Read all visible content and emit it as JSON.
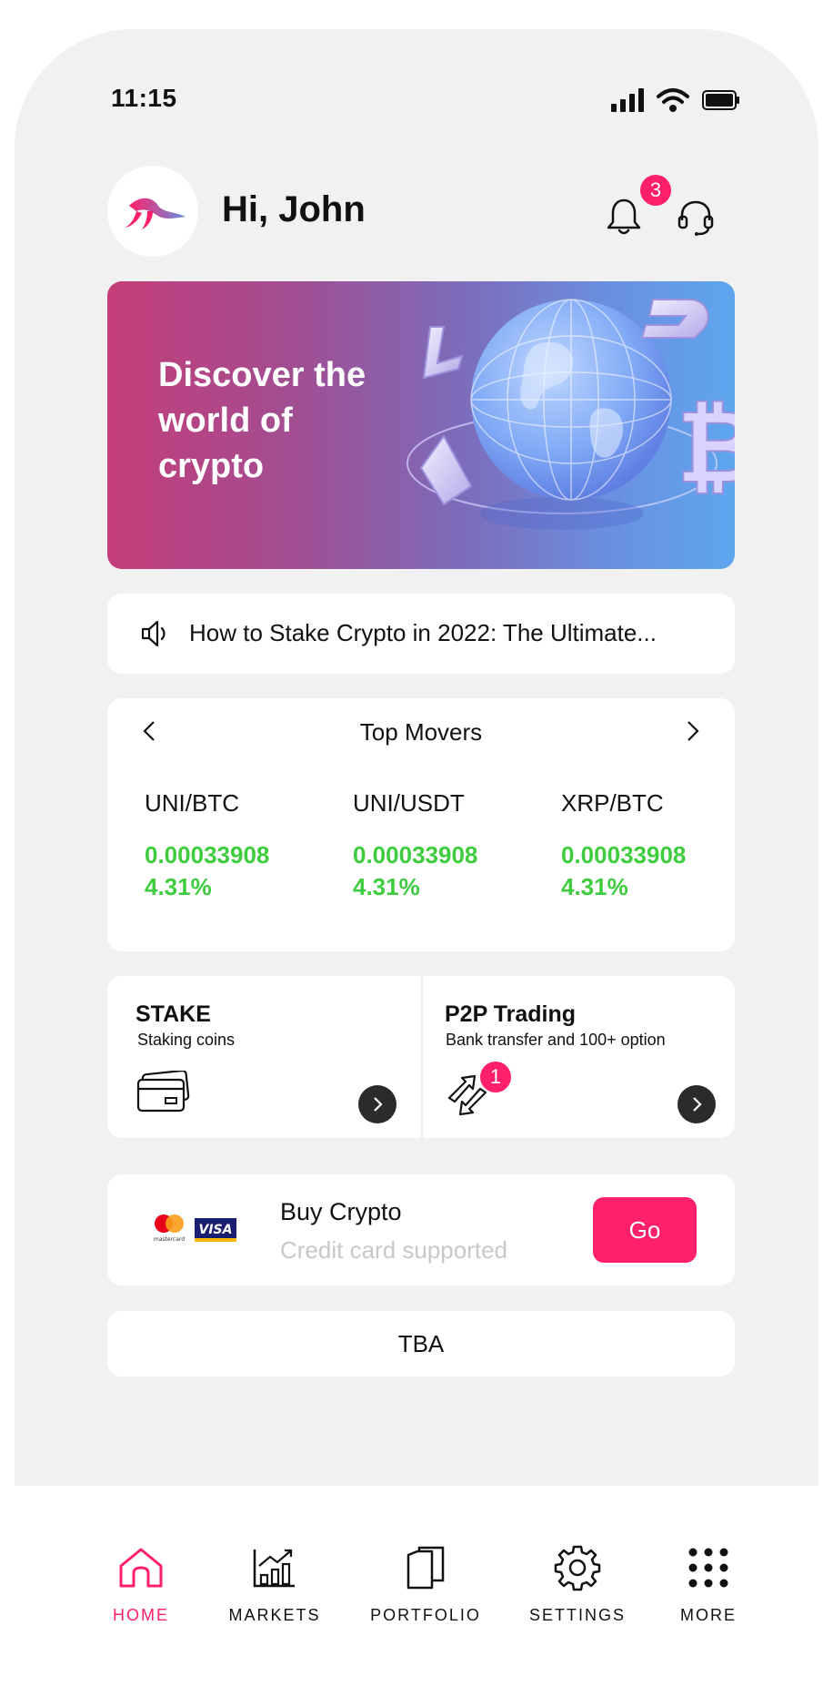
{
  "status": {
    "time": "11:15"
  },
  "header": {
    "greeting": "Hi, John",
    "notifications_count": "3"
  },
  "banner": {
    "title": "Discover the world of crypto"
  },
  "news": {
    "headline": "How to Stake Crypto in 2022: The Ultimate..."
  },
  "movers": {
    "title": "Top Movers",
    "items": [
      {
        "pair": "UNI/BTC",
        "price": "0.00033908",
        "change": "4.31%"
      },
      {
        "pair": "UNI/USDT",
        "price": "0.00033908",
        "change": "4.31%"
      },
      {
        "pair": "XRP/BTC",
        "price": "0.00033908",
        "change": "4.31%"
      }
    ]
  },
  "actions": {
    "stake": {
      "title": "STAKE",
      "subtitle": "Staking coins"
    },
    "p2p": {
      "title": "P2P Trading",
      "subtitle": "Bank transfer and 100+ option",
      "badge": "1"
    }
  },
  "buy": {
    "title": "Buy Crypto",
    "subtitle": "Credit card supported",
    "button": "Go",
    "visa_text": "VISA",
    "mastercard_text": "mastercard"
  },
  "tba": {
    "label": "TBA"
  },
  "nav": {
    "items": [
      {
        "label": "HOME",
        "icon": "home-icon",
        "active": true
      },
      {
        "label": "MARKETS",
        "icon": "chart-icon",
        "active": false
      },
      {
        "label": "PORTFOLIO",
        "icon": "portfolio-icon",
        "active": false
      },
      {
        "label": "SETTINGS",
        "icon": "gear-icon",
        "active": false
      },
      {
        "label": "MORE",
        "icon": "more-icon",
        "active": false
      }
    ]
  },
  "colors": {
    "accent": "#ff1f6a",
    "positive": "#3fcc3f",
    "background": "#f1f1f1"
  }
}
